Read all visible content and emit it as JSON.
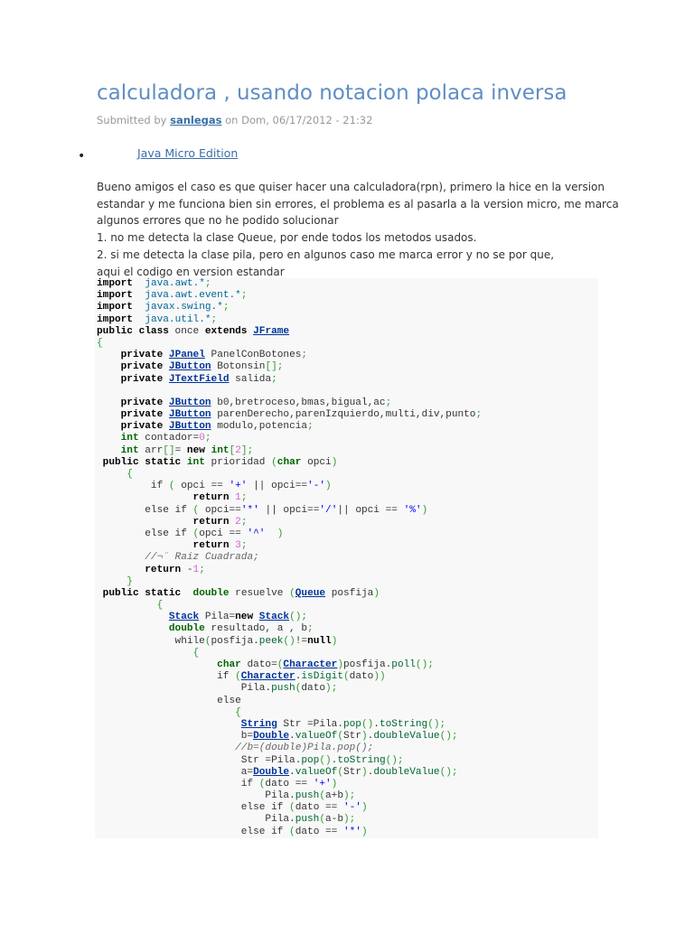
{
  "title": "calculadora , usando notacion polaca inversa",
  "meta": {
    "prefix": "Submitted by ",
    "author": "sanlegas",
    "suffix": " on Dom, 06/17/2012 - 21:32"
  },
  "tag": "Java Micro Edition",
  "body": [
    "Bueno amigos el caso es que quiser hacer una calculadora(rpn), primero la hice en la version",
    "estandar y me funciona bien sin errores, el problema es al pasarla a la version micro, me marca",
    "algunos errores que no he podido solucionar",
    "1. no me detecta la clase Queue, por ende todos los metodos usados.",
    "2. si me detecta la clase pila, pero en algunos caso me marca error y no se por que,",
    "aqui el codigo en version estandar"
  ],
  "code": [
    [
      [
        "kw",
        "import"
      ],
      [
        "",
        "  "
      ],
      [
        "pkg",
        "java.awt.*"
      ],
      [
        "p",
        ";"
      ]
    ],
    [
      [
        "kw",
        "import"
      ],
      [
        "",
        "  "
      ],
      [
        "pkg",
        "java.awt.event.*"
      ],
      [
        "p",
        ";"
      ]
    ],
    [
      [
        "kw",
        "import"
      ],
      [
        "",
        "  "
      ],
      [
        "pkg",
        "javax.swing.*"
      ],
      [
        "p",
        ";"
      ]
    ],
    [
      [
        "kw",
        "import"
      ],
      [
        "",
        "  "
      ],
      [
        "pkg",
        "java.util.*"
      ],
      [
        "p",
        ";"
      ]
    ],
    [
      [
        "kw",
        "public class"
      ],
      [
        "",
        " once "
      ],
      [
        "kw",
        "extends"
      ],
      [
        "",
        " "
      ],
      [
        "type",
        "JFrame"
      ]
    ],
    [
      [
        "p",
        "{"
      ]
    ],
    [
      [
        "",
        "    "
      ],
      [
        "kw",
        "private"
      ],
      [
        "",
        " "
      ],
      [
        "type",
        "JPanel"
      ],
      [
        "",
        " PanelConBotones"
      ],
      [
        "p",
        ";"
      ]
    ],
    [
      [
        "",
        "    "
      ],
      [
        "kw",
        "private"
      ],
      [
        "",
        " "
      ],
      [
        "type",
        "JButton"
      ],
      [
        "",
        " Botonsin"
      ],
      [
        "p",
        "[];"
      ]
    ],
    [
      [
        "",
        "    "
      ],
      [
        "kw",
        "private"
      ],
      [
        "",
        " "
      ],
      [
        "type",
        "JTextField"
      ],
      [
        "",
        " salida"
      ],
      [
        "p",
        ";"
      ]
    ],
    [
      [
        "",
        ""
      ]
    ],
    [
      [
        "",
        "    "
      ],
      [
        "kw",
        "private"
      ],
      [
        "",
        " "
      ],
      [
        "type",
        "JButton"
      ],
      [
        "",
        " b0,bretroceso,bmas,bigual,ac"
      ],
      [
        "p",
        ";"
      ]
    ],
    [
      [
        "",
        "    "
      ],
      [
        "kw",
        "private"
      ],
      [
        "",
        " "
      ],
      [
        "type",
        "JButton"
      ],
      [
        "",
        " parenDerecho,parenIzquierdo,multi,div,punto"
      ],
      [
        "p",
        ";"
      ]
    ],
    [
      [
        "",
        "    "
      ],
      [
        "kw",
        "private"
      ],
      [
        "",
        " "
      ],
      [
        "type",
        "JButton"
      ],
      [
        "",
        " modulo,potencia"
      ],
      [
        "p",
        ";"
      ]
    ],
    [
      [
        "",
        "    "
      ],
      [
        "kw2",
        "int"
      ],
      [
        "",
        " contador="
      ],
      [
        "num",
        "0"
      ],
      [
        "p",
        ";"
      ]
    ],
    [
      [
        "",
        "    "
      ],
      [
        "kw2",
        "int"
      ],
      [
        "",
        " arr"
      ],
      [
        "p",
        "[]"
      ],
      [
        "",
        "= "
      ],
      [
        "kw",
        "new"
      ],
      [
        "",
        " "
      ],
      [
        "kw2",
        "int"
      ],
      [
        "p",
        "["
      ],
      [
        "num",
        "2"
      ],
      [
        "p",
        "];"
      ]
    ],
    [
      [
        "",
        " "
      ],
      [
        "kw",
        "public static"
      ],
      [
        "",
        " "
      ],
      [
        "kw2",
        "int"
      ],
      [
        "",
        " prioridad "
      ],
      [
        "p",
        "("
      ],
      [
        "kw2",
        "char"
      ],
      [
        "",
        " opci"
      ],
      [
        "p",
        ")"
      ]
    ],
    [
      [
        "",
        "     "
      ],
      [
        "p",
        "{"
      ]
    ],
    [
      [
        "",
        "         if "
      ],
      [
        "p",
        "("
      ],
      [
        "",
        " opci == "
      ],
      [
        "str",
        "'+'"
      ],
      [
        "",
        " || opci=="
      ],
      [
        "str",
        "'-'"
      ],
      [
        "p",
        ")"
      ]
    ],
    [
      [
        "",
        "                "
      ],
      [
        "kw",
        "return"
      ],
      [
        "",
        " "
      ],
      [
        "num",
        "1"
      ],
      [
        "p",
        ";"
      ]
    ],
    [
      [
        "",
        "        else if "
      ],
      [
        "p",
        "("
      ],
      [
        "",
        " opci=="
      ],
      [
        "str",
        "'*'"
      ],
      [
        "",
        " || opci=="
      ],
      [
        "str",
        "'/'"
      ],
      [
        "",
        "|| opci == "
      ],
      [
        "str",
        "'%'"
      ],
      [
        "p",
        ")"
      ]
    ],
    [
      [
        "",
        "                "
      ],
      [
        "kw",
        "return"
      ],
      [
        "",
        " "
      ],
      [
        "num",
        "2"
      ],
      [
        "p",
        ";"
      ]
    ],
    [
      [
        "",
        "        else if "
      ],
      [
        "p",
        "("
      ],
      [
        "",
        "opci == "
      ],
      [
        "str",
        "'^'"
      ],
      [
        "",
        "  "
      ],
      [
        "p",
        ")"
      ]
    ],
    [
      [
        "",
        "                "
      ],
      [
        "kw",
        "return"
      ],
      [
        "",
        " "
      ],
      [
        "num",
        "3"
      ],
      [
        "p",
        ";"
      ]
    ],
    [
      [
        "",
        "        "
      ],
      [
        "c",
        "//¬¨ Raiz Cuadrada;"
      ]
    ],
    [
      [
        "",
        "        "
      ],
      [
        "kw",
        "return"
      ],
      [
        "",
        " -"
      ],
      [
        "num",
        "1"
      ],
      [
        "p",
        ";"
      ]
    ],
    [
      [
        "",
        "     "
      ],
      [
        "p",
        "}"
      ]
    ],
    [
      [
        "",
        " "
      ],
      [
        "kw",
        "public static"
      ],
      [
        "",
        "  "
      ],
      [
        "kw2",
        "double"
      ],
      [
        "",
        " resuelve "
      ],
      [
        "p",
        "("
      ],
      [
        "type",
        "Queue"
      ],
      [
        "",
        " posfija"
      ],
      [
        "p",
        ")"
      ]
    ],
    [
      [
        "",
        "          "
      ],
      [
        "p",
        "{"
      ]
    ],
    [
      [
        "",
        "            "
      ],
      [
        "type",
        "Stack"
      ],
      [
        "",
        " Pila="
      ],
      [
        "kw",
        "new"
      ],
      [
        "",
        " "
      ],
      [
        "type",
        "Stack"
      ],
      [
        "p",
        "();"
      ]
    ],
    [
      [
        "",
        "            "
      ],
      [
        "kw2",
        "double"
      ],
      [
        "",
        " resultado, a , b"
      ],
      [
        "p",
        ";"
      ]
    ],
    [
      [
        "",
        "             while"
      ],
      [
        "p",
        "("
      ],
      [
        "",
        "posfija."
      ],
      [
        "m",
        "peek"
      ],
      [
        "p",
        "()"
      ],
      [
        "",
        "!="
      ],
      [
        "kw",
        "null"
      ],
      [
        "p",
        ")"
      ]
    ],
    [
      [
        "",
        "                "
      ],
      [
        "p",
        "{"
      ]
    ],
    [
      [
        "",
        "                    "
      ],
      [
        "kw2",
        "char"
      ],
      [
        "",
        " dato="
      ],
      [
        "p",
        "("
      ],
      [
        "type",
        "Character"
      ],
      [
        "p",
        ")"
      ],
      [
        "",
        "posfija."
      ],
      [
        "m",
        "poll"
      ],
      [
        "p",
        "();"
      ]
    ],
    [
      [
        "",
        "                    if "
      ],
      [
        "p",
        "("
      ],
      [
        "type",
        "Character"
      ],
      [
        "",
        "."
      ],
      [
        "m",
        "isDigit"
      ],
      [
        "p",
        "("
      ],
      [
        "",
        "dato"
      ],
      [
        "p",
        "))"
      ]
    ],
    [
      [
        "",
        "                        Pila."
      ],
      [
        "m",
        "push"
      ],
      [
        "p",
        "("
      ],
      [
        "",
        "dato"
      ],
      [
        "p",
        ");"
      ]
    ],
    [
      [
        "",
        "                    else"
      ]
    ],
    [
      [
        "",
        "                       "
      ],
      [
        "p",
        "{"
      ]
    ],
    [
      [
        "",
        "                        "
      ],
      [
        "type",
        "String"
      ],
      [
        "",
        " Str =Pila."
      ],
      [
        "m",
        "pop"
      ],
      [
        "p",
        "()"
      ],
      [
        "",
        "."
      ],
      [
        "m",
        "toString"
      ],
      [
        "p",
        "();"
      ]
    ],
    [
      [
        "",
        "                        b="
      ],
      [
        "type",
        "Double"
      ],
      [
        "",
        "."
      ],
      [
        "m",
        "valueOf"
      ],
      [
        "p",
        "("
      ],
      [
        "",
        "Str"
      ],
      [
        "p",
        ")"
      ],
      [
        "",
        "."
      ],
      [
        "m",
        "doubleValue"
      ],
      [
        "p",
        "();"
      ]
    ],
    [
      [
        "",
        "                       "
      ],
      [
        "c",
        "//b=(double)Pila.pop();"
      ]
    ],
    [
      [
        "",
        "                        Str =Pila."
      ],
      [
        "m",
        "pop"
      ],
      [
        "p",
        "()"
      ],
      [
        "",
        "."
      ],
      [
        "m",
        "toString"
      ],
      [
        "p",
        "();"
      ]
    ],
    [
      [
        "",
        "                        a="
      ],
      [
        "type",
        "Double"
      ],
      [
        "",
        "."
      ],
      [
        "m",
        "valueOf"
      ],
      [
        "p",
        "("
      ],
      [
        "",
        "Str"
      ],
      [
        "p",
        ")"
      ],
      [
        "",
        "."
      ],
      [
        "m",
        "doubleValue"
      ],
      [
        "p",
        "();"
      ]
    ],
    [
      [
        "",
        "                        if "
      ],
      [
        "p",
        "("
      ],
      [
        "",
        "dato == "
      ],
      [
        "str",
        "'+'"
      ],
      [
        "p",
        ")"
      ]
    ],
    [
      [
        "",
        "                            Pila."
      ],
      [
        "m",
        "push"
      ],
      [
        "p",
        "("
      ],
      [
        "",
        "a+b"
      ],
      [
        "p",
        ");"
      ]
    ],
    [
      [
        "",
        "                        else if "
      ],
      [
        "p",
        "("
      ],
      [
        "",
        "dato == "
      ],
      [
        "str",
        "'-'"
      ],
      [
        "p",
        ")"
      ]
    ],
    [
      [
        "",
        "                            Pila."
      ],
      [
        "m",
        "push"
      ],
      [
        "p",
        "("
      ],
      [
        "",
        "a-b"
      ],
      [
        "p",
        ");"
      ]
    ],
    [
      [
        "",
        "                        else if "
      ],
      [
        "p",
        "("
      ],
      [
        "",
        "dato == "
      ],
      [
        "str",
        "'*'"
      ],
      [
        "p",
        ")"
      ]
    ]
  ]
}
